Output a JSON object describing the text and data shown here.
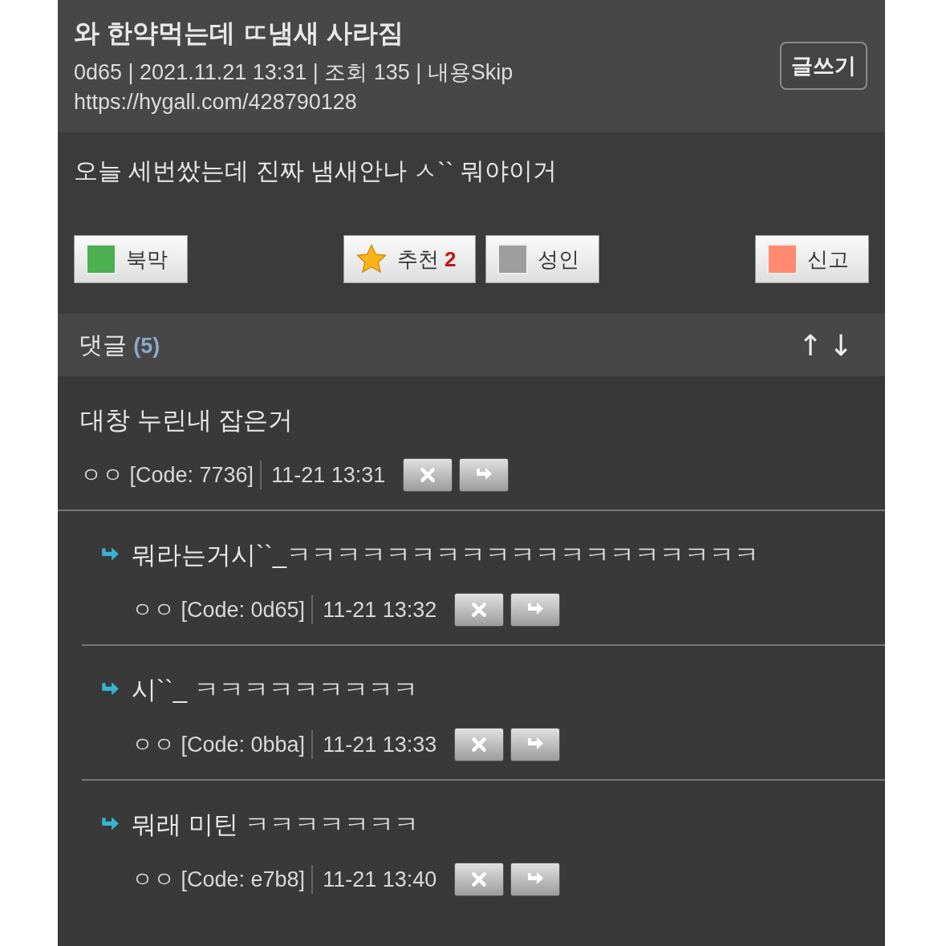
{
  "post": {
    "title": "와 한약먹는데 ㄸ냄새 사라짐",
    "meta": "0d65 | 2021.11.21 13:31 | 조회 135 | 내용Skip",
    "url": "https://hygall.com/428790128",
    "write_button": "글쓰기",
    "body": "오늘 세번쌌는데 진짜 냄새안나 ㅅ`` 뭐야이거"
  },
  "actions": [
    {
      "kind": "bookmark",
      "label": "북막",
      "color": "#4caf50"
    },
    {
      "kind": "recommend",
      "label": "추천",
      "count": "2"
    },
    {
      "kind": "adult",
      "label": "성인",
      "color": "#9e9e9e"
    },
    {
      "kind": "report",
      "label": "신고",
      "color": "#ff8a70"
    }
  ],
  "comments_header": {
    "label": "댓글",
    "count": "(5)",
    "sort_up": "↑",
    "sort_down": "↓"
  },
  "comments": [
    {
      "kind": "comment",
      "text": "대창 누린내 잡은거",
      "author": "ㅇㅇ [Code: 7736]",
      "time": "11-21 13:31"
    },
    {
      "kind": "reply",
      "text": "뭐라는거시``_ㅋㅋㅋㅋㅋㅋㅋㅋㅋㅋㅋㅋㅋㅋㅋㅋㅋㅋㅋ",
      "author": "ㅇㅇ [Code: 0d65]",
      "time": "11-21 13:32"
    },
    {
      "kind": "reply",
      "text": "시``_ ㅋㅋㅋㅋㅋㅋㅋㅋㅋ",
      "author": "ㅇㅇ [Code: 0bba]",
      "time": "11-21 13:33"
    },
    {
      "kind": "reply",
      "text": "뭐래 미틴 ㅋㅋㅋㅋㅋㅋㅋ",
      "author": "ㅇㅇ [Code: e7b8]",
      "time": "11-21 13:40"
    }
  ]
}
